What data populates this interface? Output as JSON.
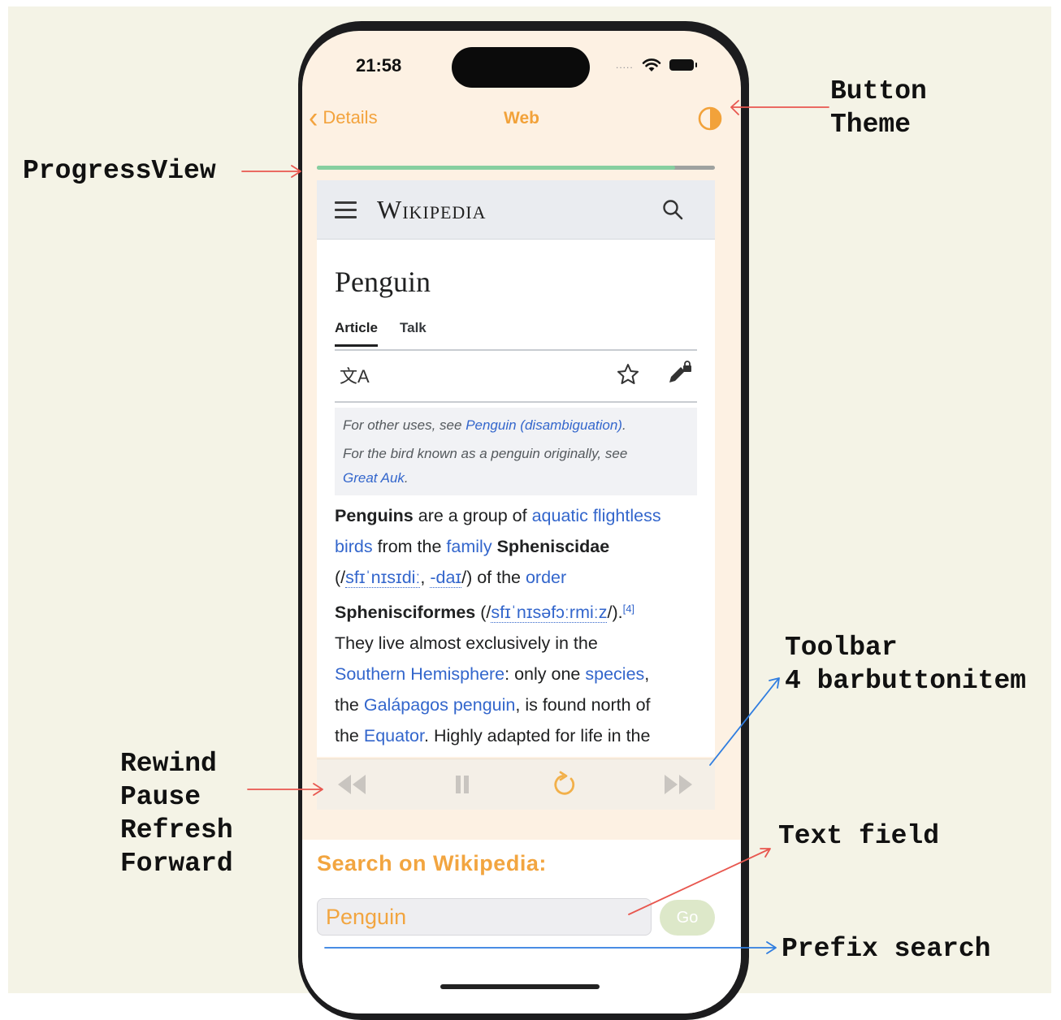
{
  "annotations": {
    "progress_view": "ProgressView",
    "button_theme": "Button\nTheme",
    "toolbar": "Toolbar\n4 barbuttonitem",
    "controls": "Rewind\nPause\nRefresh\nForward",
    "text_field": "Text field",
    "prefix_search": "Prefix search"
  },
  "status_bar": {
    "time": "21:58",
    "dots": "....."
  },
  "nav": {
    "back_label": "Details",
    "title": "Web",
    "theme_icon": "half-circle-icon"
  },
  "progress": {
    "fraction": 0.9,
    "track_color": "#9ea2a0",
    "fill_color": "#86cfa0"
  },
  "wiki": {
    "logo": "Wikipedia",
    "article_title": "Penguin",
    "tabs": [
      "Article",
      "Talk"
    ],
    "lang_icon_glyph": "文A",
    "hatnote": {
      "line1_pre": "For other uses, see ",
      "line1_link": "Penguin (disambiguation)",
      "line1_post": ".",
      "line2": "For the bird known as a penguin originally, see",
      "line3_link": "Great Auk",
      "line3_post": "."
    },
    "body": {
      "l1_b": "Penguins",
      "l1_t": " are a group of ",
      "l1_a1": "aquatic",
      "l1_sp": " ",
      "l1_a2": "flightless",
      "l2_a1": "birds",
      "l2_t1": " from the ",
      "l2_a2": "family",
      "l2_sp": " ",
      "l2_b": "Spheniscidae",
      "l3_p1": "(/",
      "l3_ipa1": "sfɪˈnɪsɪdiː",
      "l3_c": ", ",
      "l3_ipa2": "-daɪ",
      "l3_p2": "/) of the ",
      "l3_a": "order",
      "l4_b": "Sphenisciformes",
      "l4_p1": " (/",
      "l4_ipa": "sfɪˈnɪsəfɔːrmiːz",
      "l4_p2": "/).",
      "l4_ref": "[4]",
      "l5": "They live almost exclusively in the",
      "l6_a1": "Southern Hemisphere",
      "l6_t": ": only one ",
      "l6_a2": "species",
      "l6_c": ",",
      "l7_t1": "the ",
      "l7_a": "Galápagos penguin",
      "l7_t2": ", is found north of",
      "l8_t1": "the ",
      "l8_a": "Equator",
      "l8_t2": ". Highly adapted for life in the"
    }
  },
  "toolbar": {
    "buttons": [
      "rewind-icon",
      "pause-icon",
      "refresh-icon",
      "forward-icon"
    ],
    "tint_disabled": "#c9c5c0",
    "tint_active": "#f2b04a"
  },
  "search": {
    "label": "Search on Wikipedia:",
    "value": "Penguin",
    "go_label": "Go"
  },
  "colors": {
    "accent": "#f2a23a",
    "link": "#3366cc",
    "canvas": "#f4f3e6",
    "red_arrow": "#e8574f",
    "blue_arrow": "#2f7de0"
  }
}
